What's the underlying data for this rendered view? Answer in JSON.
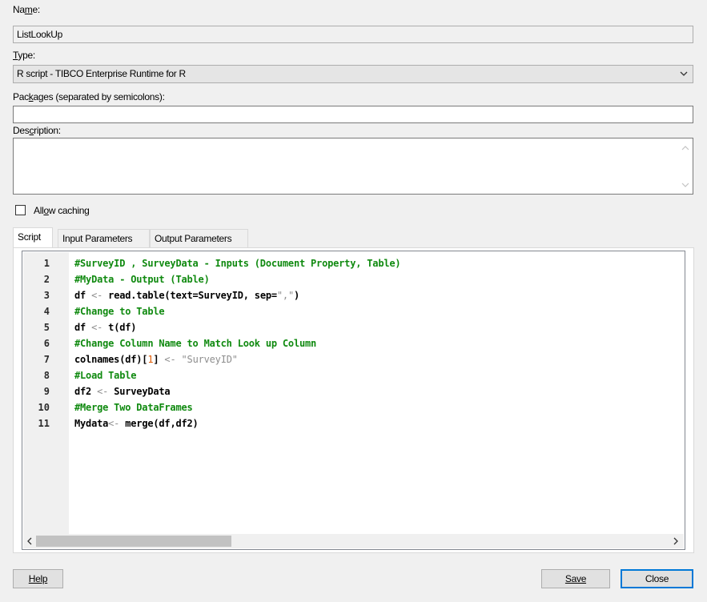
{
  "name": {
    "label": "Name:",
    "value": "ListLookUp"
  },
  "type": {
    "label": "Type:",
    "selected": "R script - TIBCO Enterprise Runtime for R"
  },
  "packages": {
    "label": "Packages (separated by semicolons):",
    "value": ""
  },
  "description": {
    "label": "Description:",
    "value": ""
  },
  "caching": {
    "label": "Allow caching",
    "checked": false
  },
  "tabs": [
    {
      "label": "Script",
      "active": true
    },
    {
      "label": "Input Parameters",
      "active": false
    },
    {
      "label": "Output Parameters",
      "active": false
    }
  ],
  "script": {
    "line_numbers": [
      "1",
      "2",
      "3",
      "4",
      "5",
      "6",
      "7",
      "8",
      "9",
      "10",
      "11"
    ],
    "lines": [
      "#SurveyID , SurveyData - Inputs (Document Property, Table)",
      "#MyData - Output (Table)",
      "df <- read.table(text=SurveyID, sep=\",\")",
      "#Change to Table",
      "df <- t(df)",
      "#Change Column Name to Match Look up Column",
      "colnames(df)[1] <- \"SurveyID\"",
      "#Load Table",
      "df2 <- SurveyData",
      "#Merge Two DataFrames",
      "Mydata<- merge(df,df2)"
    ]
  },
  "buttons": {
    "help": "Help",
    "save": "Save",
    "close": "Close"
  },
  "colors": {
    "comment": "#108a10",
    "operator": "#8e8e8e",
    "number": "#e05a00",
    "accent": "#0078d7"
  }
}
